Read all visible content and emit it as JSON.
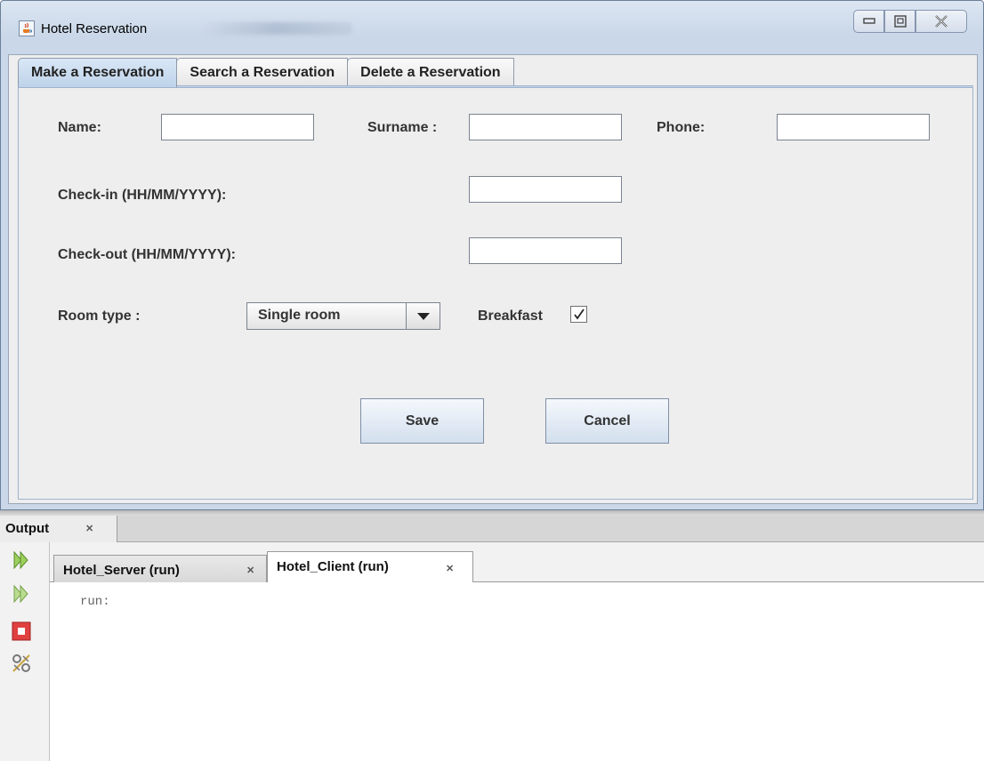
{
  "window": {
    "title": "Hotel Reservation"
  },
  "tabs": [
    {
      "label": "Make a Reservation",
      "selected": true
    },
    {
      "label": "Search a Reservation",
      "selected": false
    },
    {
      "label": "Delete a Reservation",
      "selected": false
    }
  ],
  "form": {
    "name_label": "Name:",
    "name_value": "",
    "surname_label": "Surname :",
    "surname_value": "",
    "phone_label": "Phone:",
    "phone_value": "",
    "checkin_label": "Check-in (HH/MM/YYYY):",
    "checkin_value": "",
    "checkout_label": "Check-out (HH/MM/YYYY):",
    "checkout_value": "",
    "room_type_label": "Room type :",
    "room_type_selected": "Single room",
    "breakfast_label": "Breakfast",
    "breakfast_checked": true,
    "save_label": "Save",
    "cancel_label": "Cancel"
  },
  "output": {
    "panel_title": "Output",
    "run_tabs": [
      {
        "label": "Hotel_Server (run)",
        "active": false
      },
      {
        "label": "Hotel_Client (run)",
        "active": true
      }
    ],
    "console_text": "run:"
  },
  "icons": {
    "app": "java-cup-icon",
    "minimize": "minimize-icon",
    "maximize": "maximize-icon",
    "close": "close-icon",
    "rerun": "rerun-icon",
    "rerun_alt": "rerun-with-options-icon",
    "stop": "stop-icon",
    "settings": "run-settings-icon",
    "dropdown": "chevron-down-icon",
    "check": "check-icon"
  },
  "colors": {
    "selected_tab": "#c8daee",
    "stop_red": "#e04040",
    "rerun_green": "#7fbf3f"
  }
}
